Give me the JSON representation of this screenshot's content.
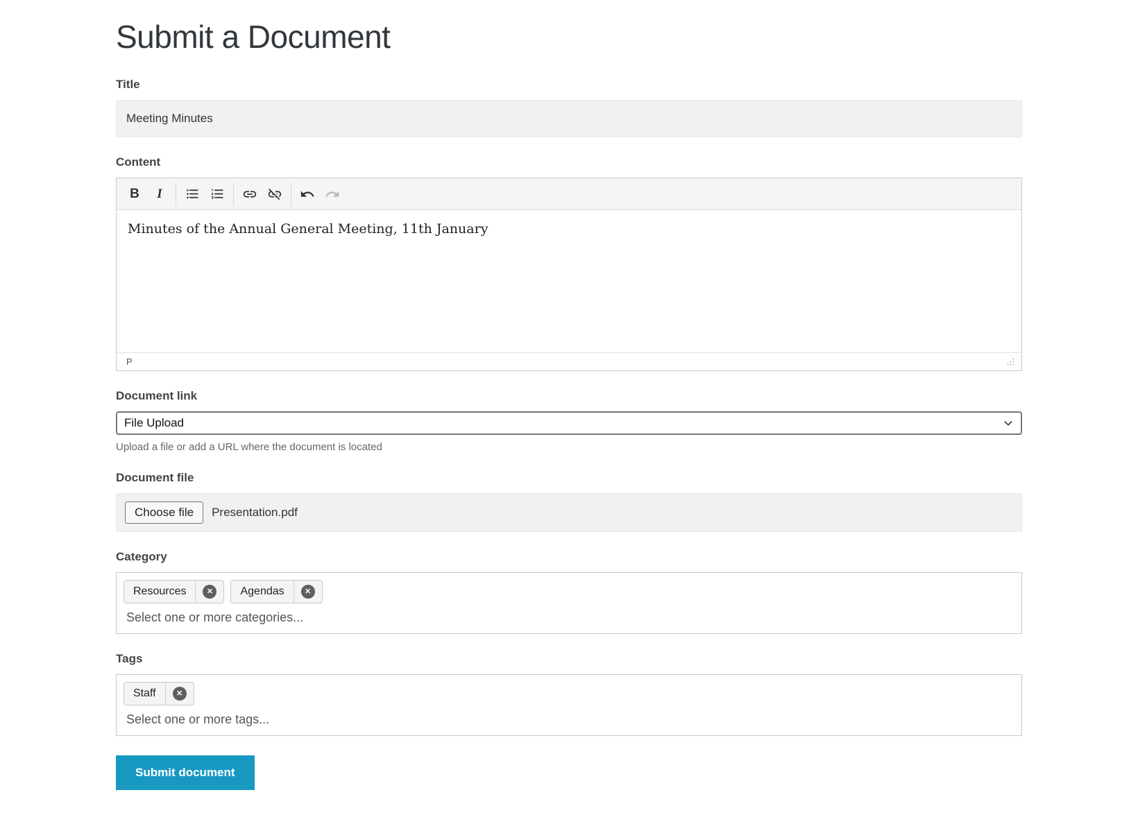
{
  "page": {
    "title": "Submit a Document"
  },
  "form": {
    "title_field": {
      "label": "Title",
      "value": "Meeting Minutes"
    },
    "content_field": {
      "label": "Content",
      "value": "Minutes of the Annual General Meeting, 11th January",
      "element_path": "P",
      "toolbar": {
        "bold_glyph": "B",
        "italic_glyph": "I",
        "icons": [
          "bold",
          "italic",
          "unordered-list",
          "ordered-list",
          "insert-link",
          "remove-link",
          "undo",
          "redo"
        ]
      }
    },
    "document_link": {
      "label": "Document link",
      "selected_option": "File Upload",
      "help_text": "Upload a file or add a URL where the document is located"
    },
    "document_file": {
      "label": "Document file",
      "button_label": "Choose file",
      "filename": "Presentation.pdf"
    },
    "category": {
      "label": "Category",
      "chips": [
        "Resources",
        "Agendas"
      ],
      "placeholder": "Select one or more categories..."
    },
    "tags": {
      "label": "Tags",
      "chips": [
        "Staff"
      ],
      "placeholder": "Select one or more tags..."
    },
    "submit_label": "Submit document"
  },
  "colors": {
    "accent": "#1899c2",
    "input_background": "#f1f1f1",
    "box_border": "#c9c9c9",
    "label_text": "#444444",
    "help_text": "#666666",
    "chip_remove_background": "#5f5f5f"
  }
}
